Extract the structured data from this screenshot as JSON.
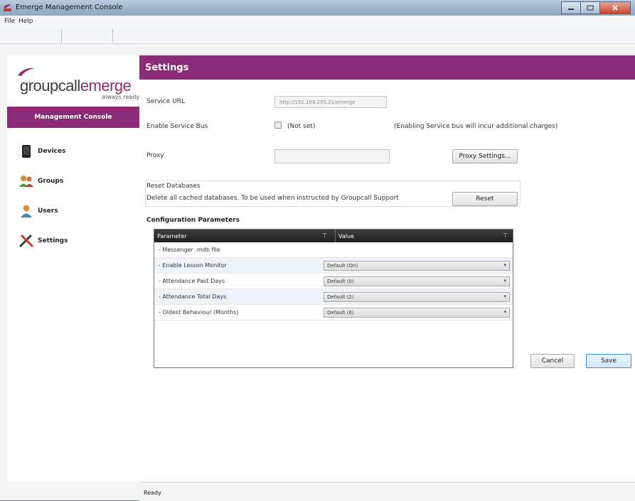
{
  "window": {
    "title": "Emerge Management Console"
  },
  "menu": {
    "file": "File",
    "help": "Help"
  },
  "brand": {
    "name_part1": "groupcall",
    "name_part2": "emerge",
    "tagline": "always ready",
    "banner": "Management Console"
  },
  "nav": {
    "items": [
      {
        "label": "Devices",
        "icon": "device-icon"
      },
      {
        "label": "Groups",
        "icon": "groups-icon"
      },
      {
        "label": "Users",
        "icon": "user-icon"
      },
      {
        "label": "Settings",
        "icon": "settings-icon"
      }
    ]
  },
  "settings": {
    "header": "Settings",
    "service_url": {
      "label": "Service URL",
      "value": "http://192.168.205.21/emerge"
    },
    "service_bus": {
      "label": "Enable Service Bus",
      "state": "(Not set)",
      "note": "(Enabling Service bus will incur additional charges)"
    },
    "proxy": {
      "label": "Proxy",
      "value": "",
      "button": "Proxy Settings..."
    },
    "reset": {
      "title": "Reset Databases",
      "desc": "Delete all cached databases. To be used when instructed by Groupcall Support",
      "button": "Reset"
    },
    "config": {
      "title": "Configuration Parameters",
      "col_param": "Parameter",
      "col_value": "Value",
      "rows": [
        {
          "name": "- Messenger .mdb file",
          "value": ""
        },
        {
          "name": "- Enable Lesson Monitor",
          "value": "Default (On)"
        },
        {
          "name": "- Attendance Past Days",
          "value": "Default (0)"
        },
        {
          "name": "- Attendance Total Days",
          "value": "Default (2)"
        },
        {
          "name": "- Oldest Behaviour (Months)",
          "value": "Default (6)"
        }
      ]
    },
    "cancel": "Cancel",
    "save": "Save"
  },
  "status": {
    "text": "Ready"
  },
  "colors": {
    "accent": "#8b2a77"
  }
}
